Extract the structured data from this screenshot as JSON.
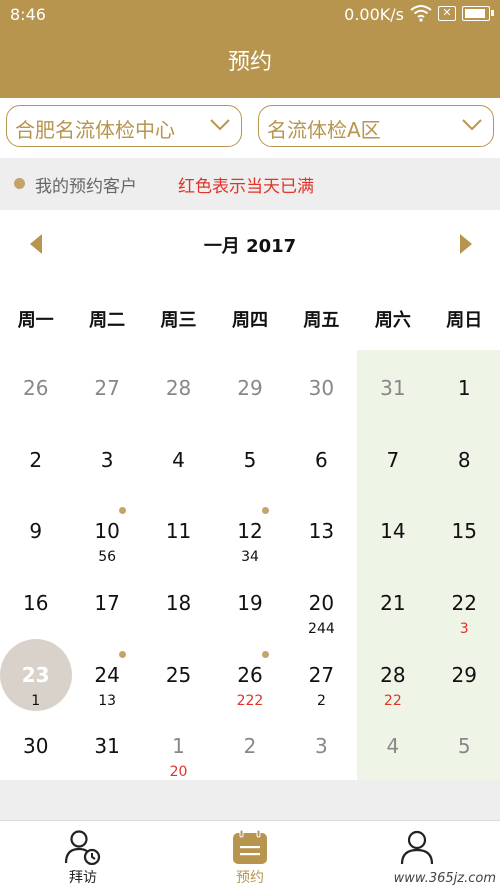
{
  "status": {
    "time": "8:46",
    "network": "0.00K/s",
    "sim": "✕"
  },
  "header": {
    "title": "预约"
  },
  "filters": {
    "center": "合肥名流体检中心",
    "area": "名流体检A区"
  },
  "legend": {
    "mine": "我的预约客户",
    "full": "红色表示当天已满"
  },
  "calendar": {
    "month_title": "一月 2017",
    "weekdays": [
      "周一",
      "周二",
      "周三",
      "周四",
      "周五",
      "周六",
      "周日"
    ],
    "weeks": [
      [
        {
          "d": "26",
          "muted": true
        },
        {
          "d": "27",
          "muted": true
        },
        {
          "d": "28",
          "muted": true
        },
        {
          "d": "29",
          "muted": true
        },
        {
          "d": "30",
          "muted": true
        },
        {
          "d": "31",
          "muted": true
        },
        {
          "d": "1"
        }
      ],
      [
        {
          "d": "2"
        },
        {
          "d": "3"
        },
        {
          "d": "4"
        },
        {
          "d": "5"
        },
        {
          "d": "6"
        },
        {
          "d": "7"
        },
        {
          "d": "8"
        }
      ],
      [
        {
          "d": "9"
        },
        {
          "d": "10",
          "mark": true,
          "sub": "56"
        },
        {
          "d": "11"
        },
        {
          "d": "12",
          "mark": true,
          "sub": "34"
        },
        {
          "d": "13"
        },
        {
          "d": "14"
        },
        {
          "d": "15"
        }
      ],
      [
        {
          "d": "16"
        },
        {
          "d": "17"
        },
        {
          "d": "18"
        },
        {
          "d": "19"
        },
        {
          "d": "20",
          "sub": "244"
        },
        {
          "d": "21"
        },
        {
          "d": "22",
          "sub": "3",
          "red": true
        }
      ],
      [
        {
          "d": "23",
          "today": true,
          "sub": "1"
        },
        {
          "d": "24",
          "mark": true,
          "sub": "13"
        },
        {
          "d": "25"
        },
        {
          "d": "26",
          "mark": true,
          "sub": "222",
          "red": true
        },
        {
          "d": "27",
          "sub": "2"
        },
        {
          "d": "28",
          "sub": "22",
          "red": true
        },
        {
          "d": "29"
        }
      ],
      [
        {
          "d": "30"
        },
        {
          "d": "31"
        },
        {
          "d": "1",
          "muted": true,
          "sub": "20",
          "red": true
        },
        {
          "d": "2",
          "muted": true
        },
        {
          "d": "3",
          "muted": true
        },
        {
          "d": "4",
          "muted": true
        },
        {
          "d": "5",
          "muted": true
        }
      ]
    ]
  },
  "tabs": [
    {
      "label": "拜访",
      "icon": "visit-person-clock-icon"
    },
    {
      "label": "预约",
      "icon": "calendar-icon",
      "active": true
    },
    {
      "label": "",
      "icon": "profile-person-icon"
    }
  ],
  "watermark": "www.365jz.com",
  "colors": {
    "accent": "#b8954e",
    "full_red": "#e0332a",
    "weekend_bg": "#eef4e6"
  }
}
